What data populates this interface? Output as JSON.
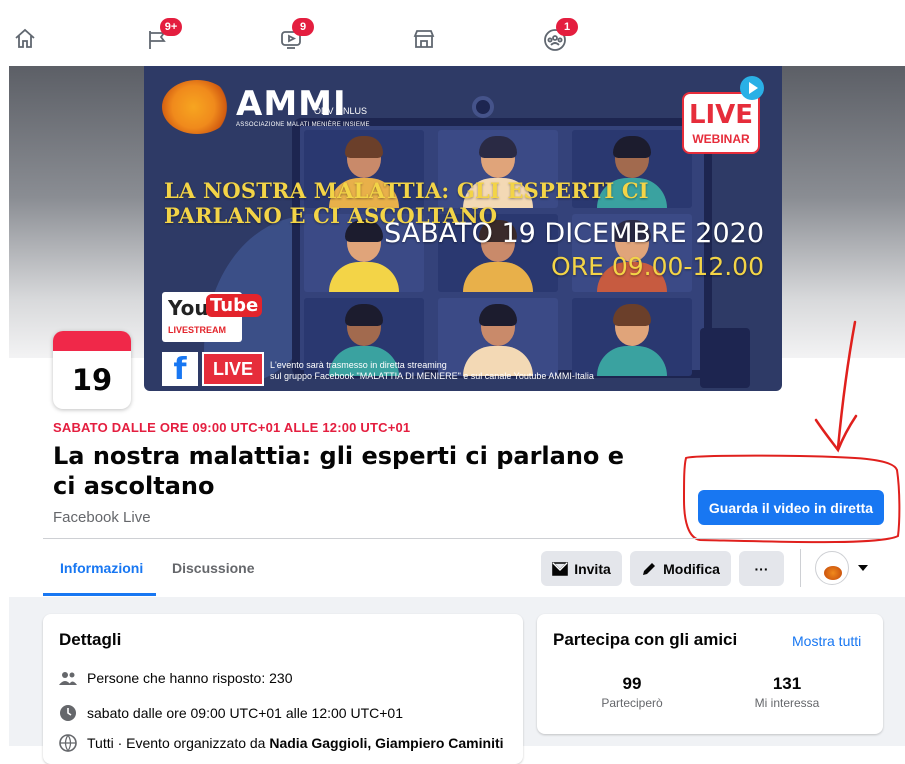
{
  "nav": {
    "items": [
      {
        "name": "home",
        "badge": ""
      },
      {
        "name": "pages",
        "badge": "9+"
      },
      {
        "name": "watch",
        "badge": "9"
      },
      {
        "name": "marketplace",
        "badge": ""
      },
      {
        "name": "groups",
        "badge": "1"
      }
    ]
  },
  "cover": {
    "org_name": "AMMI",
    "org_suffix": "ODV ONLUS",
    "org_tagline": "ASSOCIAZIONE MALATI MENIÈRE INSIEME",
    "live_word": "LIVE",
    "live_sub": "WEBINAR",
    "headline": "LA NOSTRA MALATTIA: GLI ESPERTI CI PARLANO E CI ASCOLTANO",
    "date": "SABATO 19 DICEMBRE 2020",
    "time": "ORE 09.00-12.00",
    "youtube_you": "You",
    "youtube_tube": "Tube",
    "youtube_stream": "LIVESTREAM",
    "fb_letter": "f",
    "fb_live": "LIVE",
    "stream_note_1": "L'evento sarà trasmesso in diretta streaming",
    "stream_note_2": "sul gruppo Facebook \"MALATTIA DI MENIERE\" e sul canale Youtube AMMI-Italia"
  },
  "event": {
    "calendar_day": "19",
    "date_line": "SABATO DALLE ORE 09:00 UTC+01 ALLE 12:00 UTC+01",
    "title": "La nostra malattia: gli esperti ci parlano e ci ascoltano",
    "host": "Facebook Live",
    "watch_button": "Guarda il video in diretta"
  },
  "tabs": [
    {
      "label": "Informazioni",
      "active": true
    },
    {
      "label": "Discussione",
      "active": false
    }
  ],
  "actions": {
    "invite": "Invita",
    "edit": "Modifica",
    "more": "···"
  },
  "details": {
    "title": "Dettagli",
    "responded": "Persone che hanno risposto: 230",
    "time": "sabato dalle ore 09:00 UTC+01 alle 12:00 UTC+01",
    "organizer_prefix": "Tutti · Evento organizzato da ",
    "organizers": "Nadia Gaggioli, Giampiero Caminiti"
  },
  "friends": {
    "title": "Partecipa con gli amici",
    "show_all": "Mostra tutti",
    "going_count": "99",
    "going_label": "Parteciperò",
    "interested_count": "131",
    "interested_label": "Mi interessa"
  },
  "colors": {
    "accent": "#1877f2",
    "date_red": "#e41e3f",
    "badge_red": "#e41e3f",
    "annotation_red": "#e0201d"
  }
}
